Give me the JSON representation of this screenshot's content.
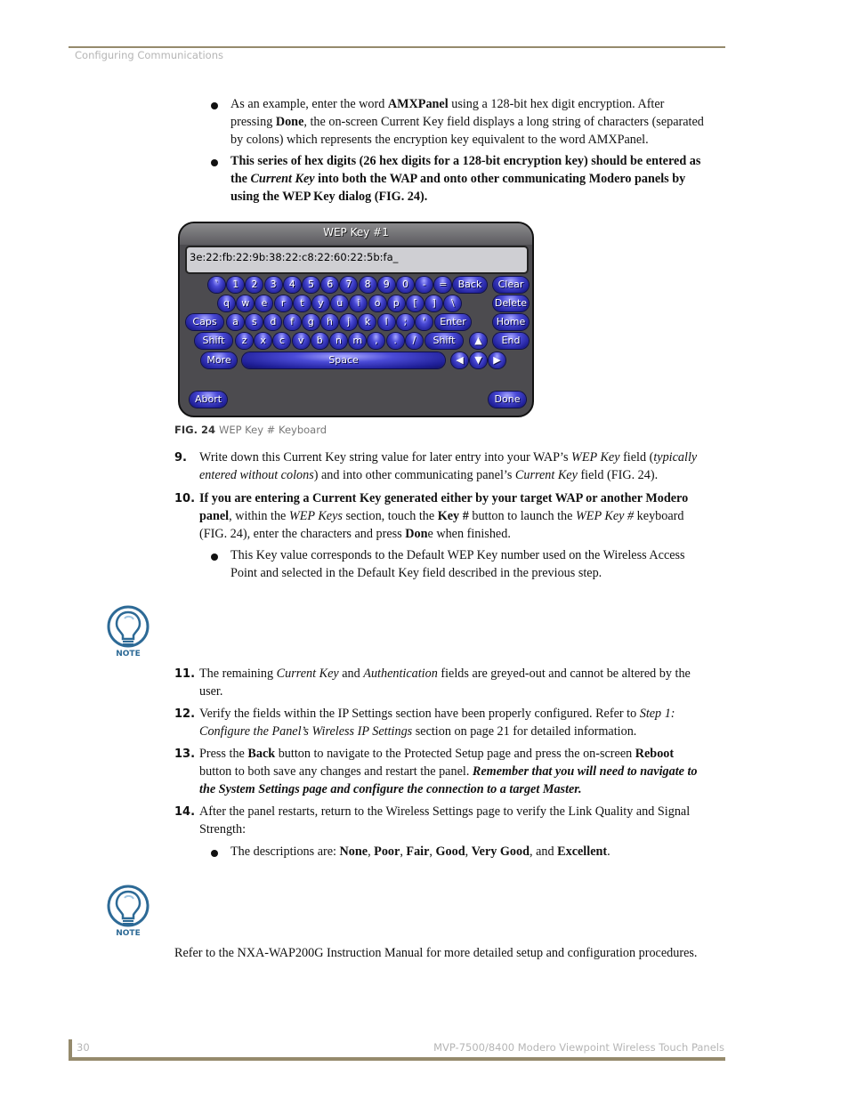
{
  "header": {
    "section": "Configuring Communications"
  },
  "footer": {
    "page_number": "30",
    "title": "MVP-7500/8400 Modero Viewpoint Wireless Touch Panels"
  },
  "bullets_top": [
    {
      "parts": [
        "As an example, enter the word ",
        "AMXPanel",
        " using a 128-bit hex digit encryption. After",
        "pressing ",
        "Done",
        ", the on-screen Current Key field displays a long string of characters (separated",
        "by colons) which represents the encryption key equivalent to the word AMXPanel."
      ]
    },
    {
      "lines": [
        "This series of hex digits (26 hex digits for a 128-bit encryption key) should be entered as",
        "Current Key",
        "into both the WAP and onto other communicating Modero panels by",
        "using the WEP Key dialog (FIG. 24)."
      ],
      "line2_prefix": "the "
    }
  ],
  "keyboard": {
    "title": "WEP Key #1",
    "field_value": "3e:22:fb:22:9b:38:22:c8:22:60:22:5b:fa_",
    "row1": [
      "`",
      "1",
      "2",
      "3",
      "4",
      "5",
      "6",
      "7",
      "8",
      "9",
      "0",
      "-",
      "="
    ],
    "row2": [
      "q",
      "w",
      "e",
      "r",
      "t",
      "y",
      "u",
      "i",
      "o",
      "p",
      "[",
      "]",
      "\\"
    ],
    "row3": [
      "a",
      "s",
      "d",
      "f",
      "g",
      "h",
      "j",
      "k",
      "l",
      ";",
      "'"
    ],
    "row4": [
      "z",
      "x",
      "c",
      "v",
      "b",
      "n",
      "m",
      ",",
      ".",
      "/"
    ],
    "back": "Back",
    "clear": "Clear",
    "delete": "Delete",
    "caps": "Caps",
    "enter": "Enter",
    "home": "Home",
    "shift": "Shift",
    "end": "End",
    "more": "More",
    "space": "Space",
    "abort": "Abort",
    "done": "Done",
    "arrow_up": "▲",
    "arrow_left": "◀",
    "arrow_down": "▼",
    "arrow_right": "▶"
  },
  "figure": {
    "label": "FIG. 24",
    "caption": "WEP Key # Keyboard"
  },
  "steps": {
    "s9": {
      "num": "9.",
      "l1a": "Write down this Current Key string value for later entry into your WAP’s ",
      "l1b": "WEP Key",
      "l1c": " field (",
      "l1d": "typically",
      "l2a": "entered without colons",
      "l2b": ") and into other communicating panel’s ",
      "l2c": "Current Key",
      "l2d": " field (FIG. 24)."
    },
    "s10": {
      "num": "10.",
      "l1": "If you are entering a Current Key generated either by your target WAP or another Modero",
      "l2a": "panel",
      "l2b": ", within the ",
      "l2c": "WEP Keys",
      "l2d": " section, touch the ",
      "l2e": "Key #",
      "l2f": " button to launch the ",
      "l2g": "WEP Key #",
      "l2h": " keyboard",
      "l3a": "(FIG. 24), enter the characters and press ",
      "l3b": "Don",
      "l3c": "e when finished.",
      "bullet_l1": "This Key value corresponds to the Default WEP Key number used on the Wireless Access",
      "bullet_l2": "Point and selected in the Default Key field described in the previous step."
    },
    "s11": {
      "num": "11.",
      "l1a": "The remaining ",
      "l1b": "Current Key",
      "l1c": " and ",
      "l1d": "Authentication",
      "l1e": " fields are greyed-out and cannot be altered by the",
      "l2": "user."
    },
    "s12": {
      "num": "12.",
      "l1a": "Verify the fields within the IP Settings section have been properly configured. Refer to ",
      "l1b": "Step 1:",
      "l2a": "Configure the Panel’s Wireless IP Settings",
      "l2b": " section on page 21 for detailed information."
    },
    "s13": {
      "num": "13.",
      "l1a": "Press the ",
      "l1b": "Back",
      "l1c": " button to navigate to the Protected Setup page and press the on-screen ",
      "l1d": "Reboot",
      "l2a": "button to both save any changes and restart the panel. ",
      "l2b": "Remember that you will need to navigate to",
      "l3": "the System Settings page and configure the connection to a target Master."
    },
    "s14": {
      "num": "14.",
      "l1": "After the panel restarts, return to the Wireless Settings page to verify the Link Quality and Signal",
      "l2": "Strength:",
      "bullet": [
        "The descriptions are: ",
        "None",
        ", ",
        "Poor",
        ", ",
        "Fair",
        ", ",
        "Good",
        ", ",
        "Very Good",
        ", and ",
        "Excellent",
        "."
      ]
    }
  },
  "note_label": "NOTE",
  "closing": "Refer to the NXA-WAP200G Instruction Manual for more detailed setup and configuration procedures."
}
